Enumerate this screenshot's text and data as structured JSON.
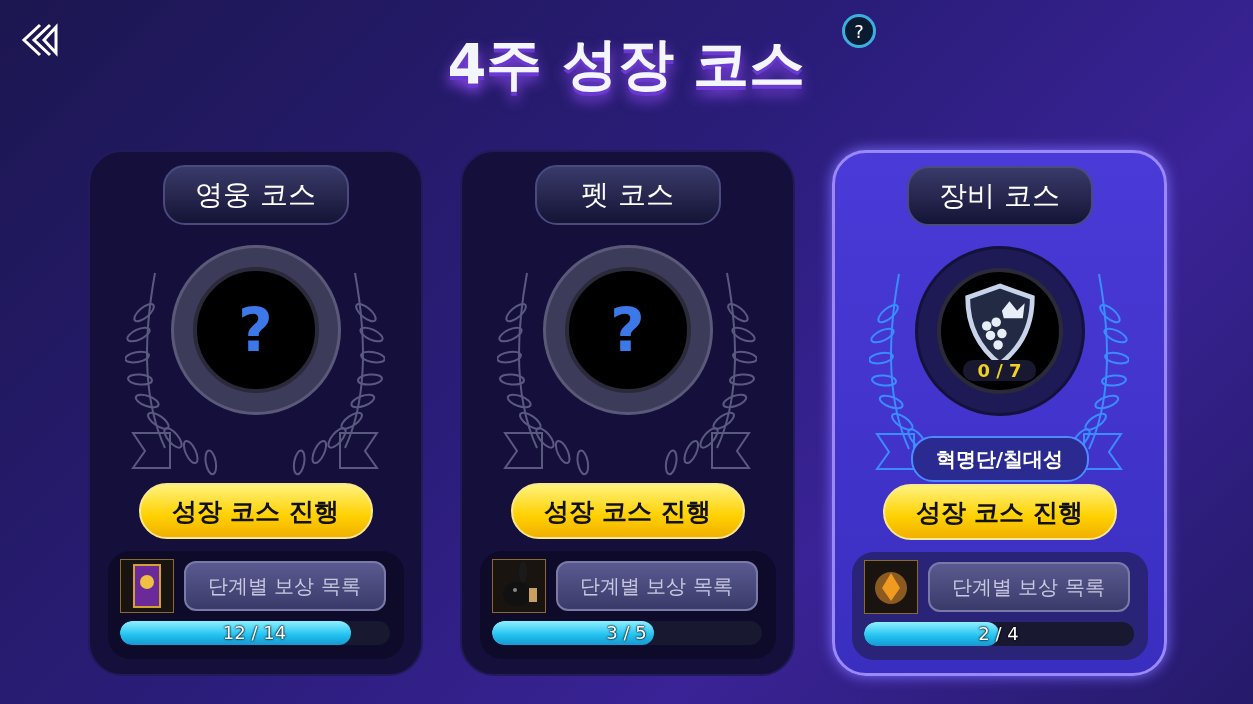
{
  "title": "4주 성장 코스",
  "courses": [
    {
      "name": "영웅 코스",
      "selected": false,
      "emblem": {
        "kind": "unknown",
        "mark": "?"
      },
      "button": "성장 코스 진행",
      "thumb": {
        "kind": "card"
      },
      "rewards_button": "단계별 보상 목록",
      "progress": "12 / 14",
      "level": 0.857
    },
    {
      "name": "펫 코스",
      "selected": false,
      "emblem": {
        "kind": "unknown",
        "mark": "?"
      },
      "button": "성장 코스 진행",
      "thumb": {
        "kind": "pet"
      },
      "rewards_button": "단계별 보상 목록",
      "progress": "3 / 5",
      "level": 0.6
    },
    {
      "name": "장비 코스",
      "selected": true,
      "emblem": {
        "kind": "shield",
        "count": "0 / 7"
      },
      "ribbon": "혁명단/칠대성",
      "button": "성장 코스 진행",
      "thumb": {
        "kind": "crest"
      },
      "rewards_button": "단계별 보상 목록",
      "progress": "2 / 4",
      "level": 0.5
    }
  ],
  "help": "?"
}
